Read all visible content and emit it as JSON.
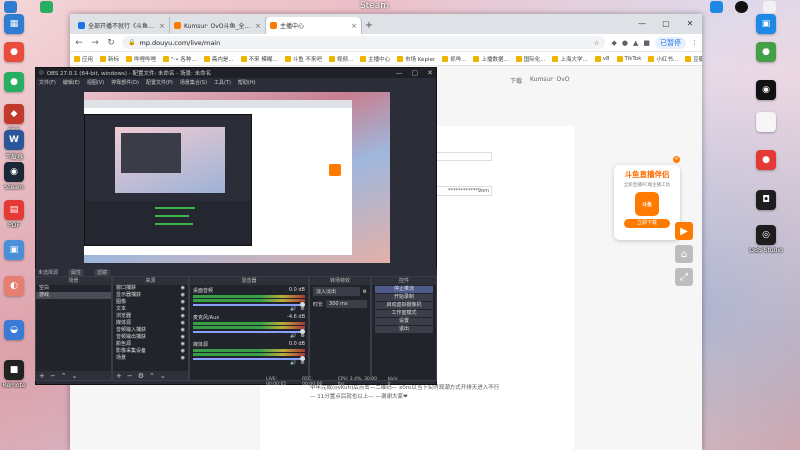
{
  "desktop": {
    "top_text": "Steam",
    "left_icons": [
      {
        "label": "",
        "color": "#2d7dd2",
        "glyph": "▦"
      },
      {
        "label": "",
        "color": "#e74c3c",
        "glyph": "●"
      },
      {
        "label": "",
        "color": "#27ae60",
        "glyph": "●"
      },
      {
        "label": "实监",
        "color": "#c0392b",
        "glyph": "◆"
      },
      {
        "label": "下载器",
        "color": "#2b579a",
        "glyph": "W"
      },
      {
        "label": "Steam",
        "color": "#1b2838",
        "glyph": "◉"
      },
      {
        "label": "PDF",
        "color": "#e53935",
        "glyph": "▤"
      },
      {
        "label": "",
        "color": "#4a90d9",
        "glyph": "▣"
      },
      {
        "label": "",
        "color": "#e67e73",
        "glyph": "◐"
      },
      {
        "label": "",
        "color": "#3a7bd5",
        "glyph": "◒"
      },
      {
        "label": "Remote",
        "color": "#222222",
        "glyph": "■"
      }
    ],
    "right_icons": [
      {
        "label": "",
        "color": "#1e88e5",
        "glyph": "▣"
      },
      {
        "label": "",
        "color": "#43a047",
        "glyph": "●"
      },
      {
        "label": "",
        "color": "#111111",
        "glyph": "◉"
      },
      {
        "label": "",
        "color": "#f5f5f5",
        "glyph": "▢"
      },
      {
        "label": "",
        "color": "#e53935",
        "glyph": "●"
      },
      {
        "label": "",
        "color": "#1e1e1e",
        "glyph": "◘"
      },
      {
        "label": "OBS Studio",
        "color": "#1e1e1e",
        "glyph": "◎"
      }
    ]
  },
  "browser": {
    "tabs": [
      {
        "title": "全部开播不就行《斗鱼直播》...",
        "color": "#1a73e8",
        "active": false
      },
      {
        "title": "Kumsur· OvO斗鱼_全民直播...",
        "color": "#ff7a00",
        "active": false
      },
      {
        "title": "主播中心",
        "color": "#ff7a00",
        "active": true
      }
    ],
    "url": "mp.douyu.com/live/main",
    "pause_label": "已暂停",
    "bookmarks": [
      "应用",
      "新标",
      "哔哩哔哩",
      "\"⋅• 各种…",
      "斋内是...",
      "不来 模糊...",
      "斗鱼 不来吧",
      "视频...",
      "主播中心",
      "市场 Kepler",
      "抓哔...",
      "上播数据...",
      "国际化...",
      "上海大学...",
      "v8",
      "TikTok",
      "小红书...",
      "豆瓣",
      "斗鱼...",
      "开发文档",
      "新一轮...",
      "收藏的网站"
    ],
    "site_top": [
      "下载",
      "Kumsur· OvO"
    ],
    "stream_key": "************9om",
    "description": "中年完成(ovKuh)后点击—二维码— x0ro以当下实时观潮方式开排天进入不行— 11分置点后就也以上— —谢谢大家❤",
    "promo": {
      "title": "斗鱼直播伴侣",
      "subtitle": "全新直播PC端主播工具",
      "logo_text": "斗鱼",
      "button": "立即下载"
    }
  },
  "obs": {
    "title": "OBS 27.0.1 (64-bit, windows) - 配置文件: 未命名 - 场景: 未命名",
    "menu": [
      "文件(F)",
      "编辑(E)",
      "视图(V)",
      "停靠部件(D)",
      "配置文件(P)",
      "场景集合(S)",
      "工具(T)",
      "帮助(H)"
    ],
    "selection_bar": [
      "未选择源",
      "属性",
      "滤镜"
    ],
    "docks": {
      "scenes": {
        "title": "场景",
        "items": [
          "空白",
          "游戏"
        ]
      },
      "sources": {
        "title": "来源",
        "items": [
          "窗口捕获",
          "显示器捕获",
          "图像",
          "文本",
          "浏览器",
          "媒体源",
          "音频输入捕获",
          "音频输出捕获",
          "颜色源",
          "影像采集设备",
          "场景"
        ]
      },
      "mixer": {
        "title": "混音器",
        "channels": [
          {
            "name": "桌面音频",
            "db": "0.0 dB"
          },
          {
            "name": "麦克风/Aux",
            "db": "-4.6 dB"
          },
          {
            "name": "媒体源",
            "db": "0.0 dB"
          }
        ]
      },
      "transitions": {
        "title": "转场特效",
        "selected": "淡入淡出",
        "duration_label": "时长",
        "duration": "300 ms"
      },
      "controls": {
        "title": "控件",
        "buttons": [
          "停止推流",
          "开始录制",
          "启动虚拟摄像机",
          "工作室模式",
          "设置",
          "退出"
        ]
      }
    },
    "status": [
      "LIVE: 00:00:05",
      "REC: 00:00:00",
      "CPU: 3.4%, 30.00 fps",
      "kb/s: 0"
    ]
  }
}
